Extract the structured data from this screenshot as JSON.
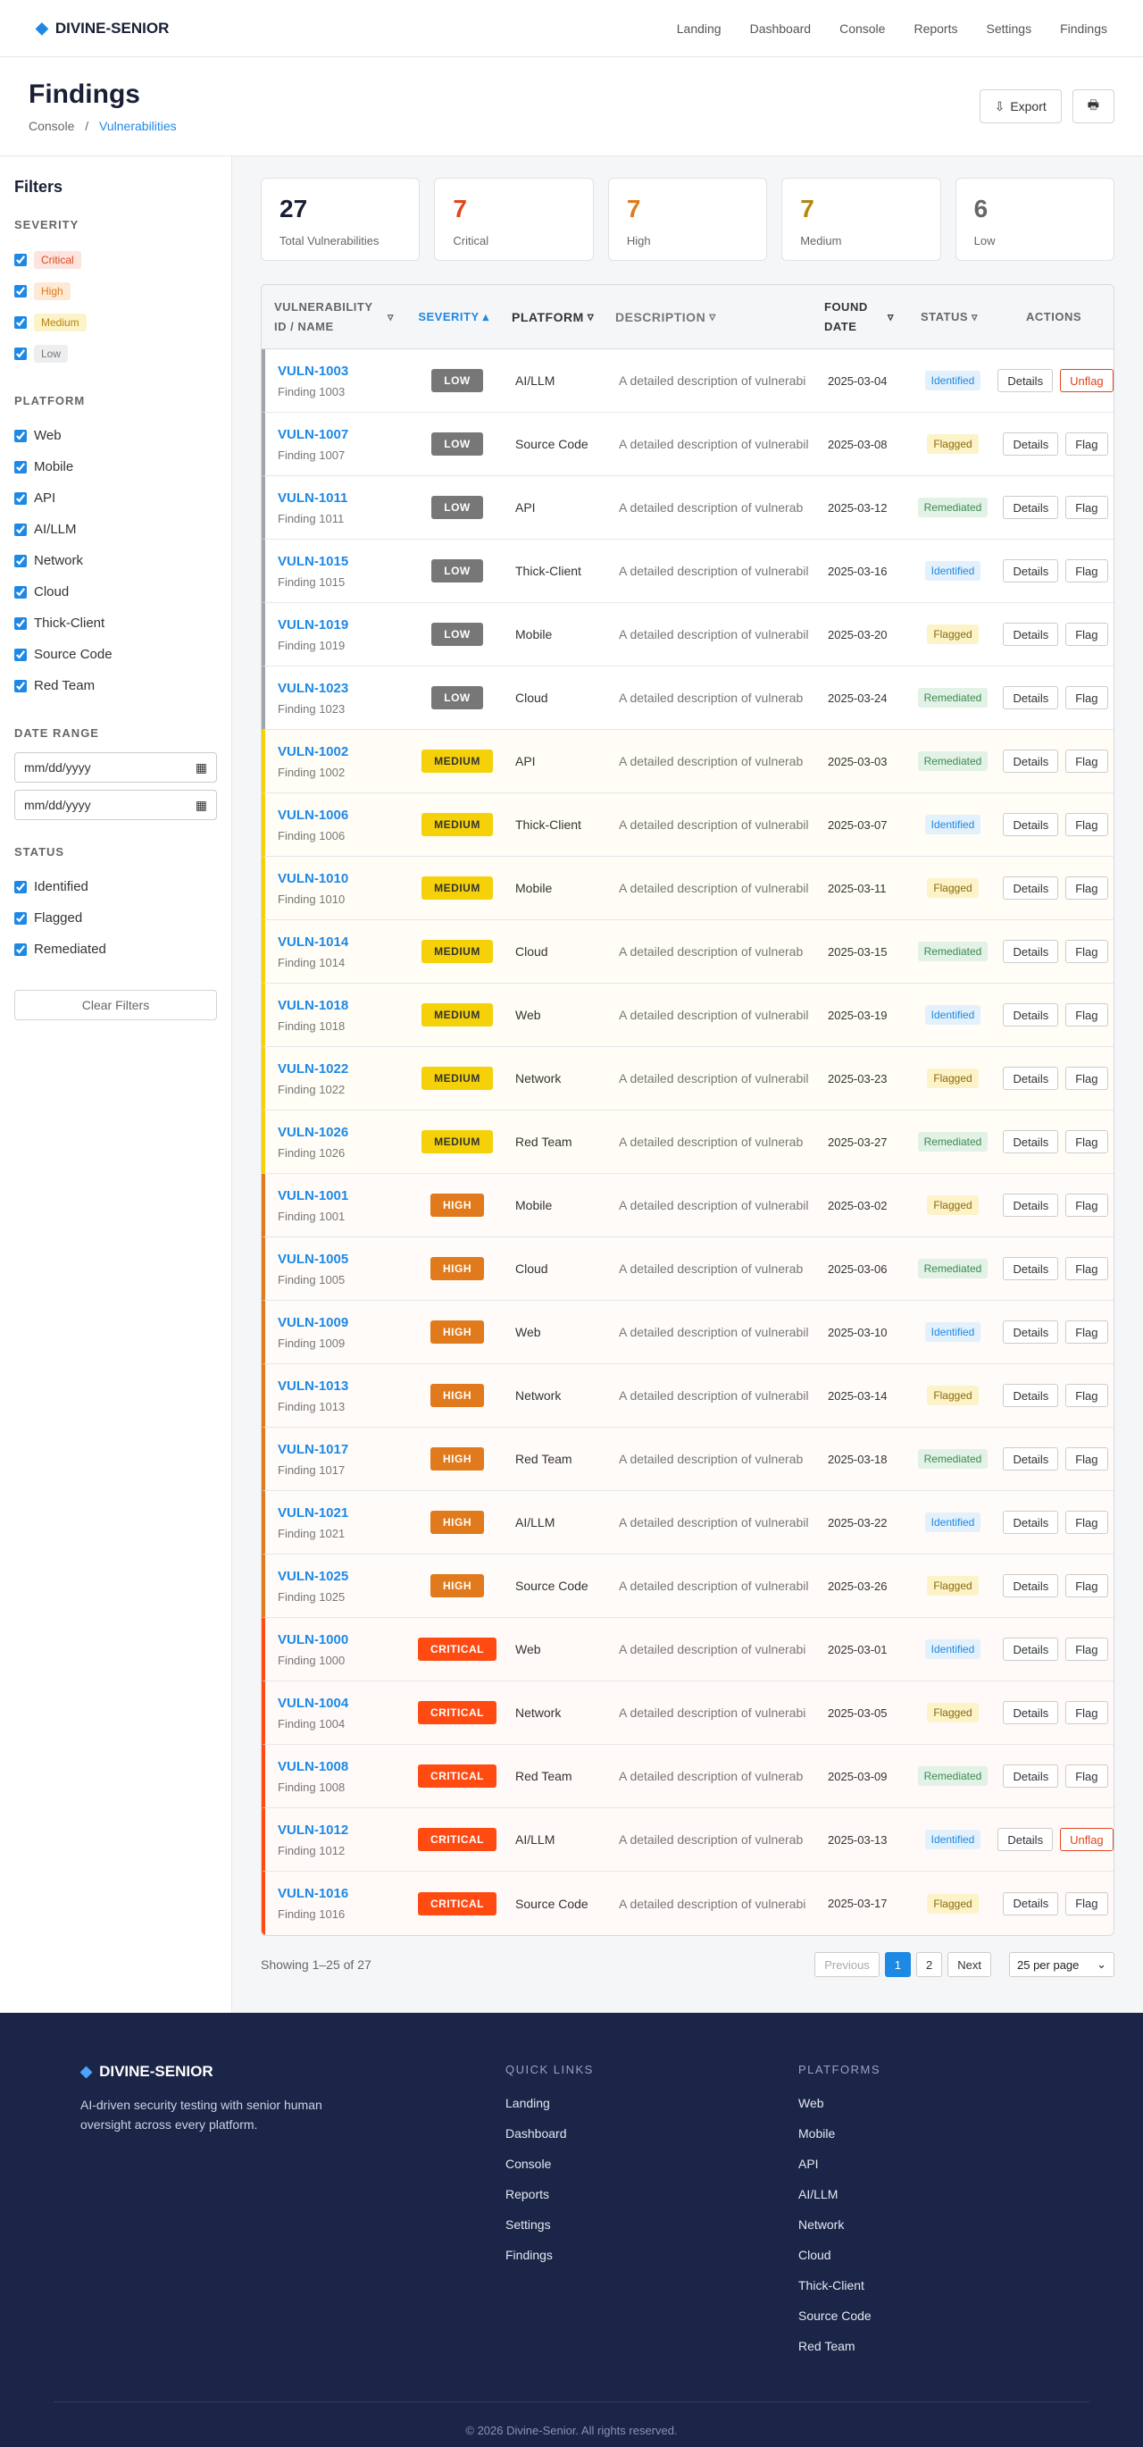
{
  "brand": "DIVINE-SENIOR",
  "nav": [
    "Landing",
    "Dashboard",
    "Console",
    "Reports",
    "Settings",
    "Findings"
  ],
  "page": {
    "title": "Findings",
    "breadcrumb": [
      "Console",
      "Vulnerabilities"
    ],
    "export_label": "Export",
    "export_icon": "download-icon",
    "print_icon": "print-icon"
  },
  "filters": {
    "title": "Filters",
    "severity_title": "SEVERITY",
    "severity": [
      "Critical",
      "High",
      "Medium",
      "Low"
    ],
    "platform_title": "PLATFORM",
    "platform": [
      "Web",
      "Mobile",
      "API",
      "AI/LLM",
      "Network",
      "Cloud",
      "Thick-Client",
      "Source Code",
      "Red Team"
    ],
    "date_title": "DATE RANGE",
    "date_placeholder": "mm/dd/yyyy",
    "status_title": "STATUS",
    "status": [
      "Identified",
      "Flagged",
      "Remediated"
    ],
    "clear_label": "Clear Filters"
  },
  "stats": [
    {
      "value": "27",
      "label": "Total Vulnerabilities",
      "color": "#1a1f36"
    },
    {
      "value": "7",
      "label": "Critical",
      "color": "#e0451c"
    },
    {
      "value": "7",
      "label": "High",
      "color": "#e07a1c"
    },
    {
      "value": "7",
      "label": "Medium",
      "color": "#b3860d"
    },
    {
      "value": "6",
      "label": "Low",
      "color": "#666666"
    }
  ],
  "table": {
    "headers": {
      "id": "VULNERABILITY ID / NAME",
      "severity": "SEVERITY",
      "platform": "PLATFORM",
      "description": "DESCRIPTION",
      "date": "FOUND DATE",
      "status": "STATUS",
      "actions": "ACTIONS"
    },
    "details_label": "Details",
    "rows": [
      {
        "id": "VULN-1003",
        "name": "Finding 1003",
        "severity": "LOW",
        "platform": "AI/LLM",
        "description": "A detailed description of vulnerabi",
        "date": "2025-03-04",
        "status": "Identified",
        "flag": "Unflag"
      },
      {
        "id": "VULN-1007",
        "name": "Finding 1007",
        "severity": "LOW",
        "platform": "Source Code",
        "description": "A detailed description of vulnerabil",
        "date": "2025-03-08",
        "status": "Flagged",
        "flag": "Flag"
      },
      {
        "id": "VULN-1011",
        "name": "Finding 1011",
        "severity": "LOW",
        "platform": "API",
        "description": "A detailed description of vulnerab",
        "date": "2025-03-12",
        "status": "Remediated",
        "flag": "Flag"
      },
      {
        "id": "VULN-1015",
        "name": "Finding 1015",
        "severity": "LOW",
        "platform": "Thick-Client",
        "description": "A detailed description of vulnerabil",
        "date": "2025-03-16",
        "status": "Identified",
        "flag": "Flag"
      },
      {
        "id": "VULN-1019",
        "name": "Finding 1019",
        "severity": "LOW",
        "platform": "Mobile",
        "description": "A detailed description of vulnerabil",
        "date": "2025-03-20",
        "status": "Flagged",
        "flag": "Flag"
      },
      {
        "id": "VULN-1023",
        "name": "Finding 1023",
        "severity": "LOW",
        "platform": "Cloud",
        "description": "A detailed description of vulnerab",
        "date": "2025-03-24",
        "status": "Remediated",
        "flag": "Flag"
      },
      {
        "id": "VULN-1002",
        "name": "Finding 1002",
        "severity": "MEDIUM",
        "platform": "API",
        "description": "A detailed description of vulnerab",
        "date": "2025-03-03",
        "status": "Remediated",
        "flag": "Flag"
      },
      {
        "id": "VULN-1006",
        "name": "Finding 1006",
        "severity": "MEDIUM",
        "platform": "Thick-Client",
        "description": "A detailed description of vulnerabil",
        "date": "2025-03-07",
        "status": "Identified",
        "flag": "Flag"
      },
      {
        "id": "VULN-1010",
        "name": "Finding 1010",
        "severity": "MEDIUM",
        "platform": "Mobile",
        "description": "A detailed description of vulnerabil",
        "date": "2025-03-11",
        "status": "Flagged",
        "flag": "Flag"
      },
      {
        "id": "VULN-1014",
        "name": "Finding 1014",
        "severity": "MEDIUM",
        "platform": "Cloud",
        "description": "A detailed description of vulnerab",
        "date": "2025-03-15",
        "status": "Remediated",
        "flag": "Flag"
      },
      {
        "id": "VULN-1018",
        "name": "Finding 1018",
        "severity": "MEDIUM",
        "platform": "Web",
        "description": "A detailed description of vulnerabil",
        "date": "2025-03-19",
        "status": "Identified",
        "flag": "Flag"
      },
      {
        "id": "VULN-1022",
        "name": "Finding 1022",
        "severity": "MEDIUM",
        "platform": "Network",
        "description": "A detailed description of vulnerabil",
        "date": "2025-03-23",
        "status": "Flagged",
        "flag": "Flag"
      },
      {
        "id": "VULN-1026",
        "name": "Finding 1026",
        "severity": "MEDIUM",
        "platform": "Red Team",
        "description": "A detailed description of vulnerab",
        "date": "2025-03-27",
        "status": "Remediated",
        "flag": "Flag"
      },
      {
        "id": "VULN-1001",
        "name": "Finding 1001",
        "severity": "HIGH",
        "platform": "Mobile",
        "description": "A detailed description of vulnerabil",
        "date": "2025-03-02",
        "status": "Flagged",
        "flag": "Flag"
      },
      {
        "id": "VULN-1005",
        "name": "Finding 1005",
        "severity": "HIGH",
        "platform": "Cloud",
        "description": "A detailed description of vulnerab",
        "date": "2025-03-06",
        "status": "Remediated",
        "flag": "Flag"
      },
      {
        "id": "VULN-1009",
        "name": "Finding 1009",
        "severity": "HIGH",
        "platform": "Web",
        "description": "A detailed description of vulnerabil",
        "date": "2025-03-10",
        "status": "Identified",
        "flag": "Flag"
      },
      {
        "id": "VULN-1013",
        "name": "Finding 1013",
        "severity": "HIGH",
        "platform": "Network",
        "description": "A detailed description of vulnerabil",
        "date": "2025-03-14",
        "status": "Flagged",
        "flag": "Flag"
      },
      {
        "id": "VULN-1017",
        "name": "Finding 1017",
        "severity": "HIGH",
        "platform": "Red Team",
        "description": "A detailed description of vulnerab",
        "date": "2025-03-18",
        "status": "Remediated",
        "flag": "Flag"
      },
      {
        "id": "VULN-1021",
        "name": "Finding 1021",
        "severity": "HIGH",
        "platform": "AI/LLM",
        "description": "A detailed description of vulnerabil",
        "date": "2025-03-22",
        "status": "Identified",
        "flag": "Flag"
      },
      {
        "id": "VULN-1025",
        "name": "Finding 1025",
        "severity": "HIGH",
        "platform": "Source Code",
        "description": "A detailed description of vulnerabil",
        "date": "2025-03-26",
        "status": "Flagged",
        "flag": "Flag"
      },
      {
        "id": "VULN-1000",
        "name": "Finding 1000",
        "severity": "CRITICAL",
        "platform": "Web",
        "description": "A detailed description of vulnerabi",
        "date": "2025-03-01",
        "status": "Identified",
        "flag": "Flag"
      },
      {
        "id": "VULN-1004",
        "name": "Finding 1004",
        "severity": "CRITICAL",
        "platform": "Network",
        "description": "A detailed description of vulnerabi",
        "date": "2025-03-05",
        "status": "Flagged",
        "flag": "Flag"
      },
      {
        "id": "VULN-1008",
        "name": "Finding 1008",
        "severity": "CRITICAL",
        "platform": "Red Team",
        "description": "A detailed description of vulnerab",
        "date": "2025-03-09",
        "status": "Remediated",
        "flag": "Flag"
      },
      {
        "id": "VULN-1012",
        "name": "Finding 1012",
        "severity": "CRITICAL",
        "platform": "AI/LLM",
        "description": "A detailed description of vulnerab",
        "date": "2025-03-13",
        "status": "Identified",
        "flag": "Unflag"
      },
      {
        "id": "VULN-1016",
        "name": "Finding 1016",
        "severity": "CRITICAL",
        "platform": "Source Code",
        "description": "A detailed description of vulnerabi",
        "date": "2025-03-17",
        "status": "Flagged",
        "flag": "Flag"
      }
    ]
  },
  "pagination": {
    "info": "Showing 1–25 of 27",
    "previous": "Previous",
    "pages": [
      "1",
      "2"
    ],
    "next": "Next",
    "per_page": "25 per page"
  },
  "footer": {
    "tagline": "AI-driven security testing with senior human oversight across every platform.",
    "quick_links_title": "QUICK LINKS",
    "quick_links": [
      "Landing",
      "Dashboard",
      "Console",
      "Reports",
      "Settings",
      "Findings"
    ],
    "platforms_title": "PLATFORMS",
    "platforms": [
      "Web",
      "Mobile",
      "API",
      "AI/LLM",
      "Network",
      "Cloud",
      "Thick-Client",
      "Source Code",
      "Red Team"
    ],
    "copyright": "© 2026 Divine-Senior. All rights reserved."
  }
}
